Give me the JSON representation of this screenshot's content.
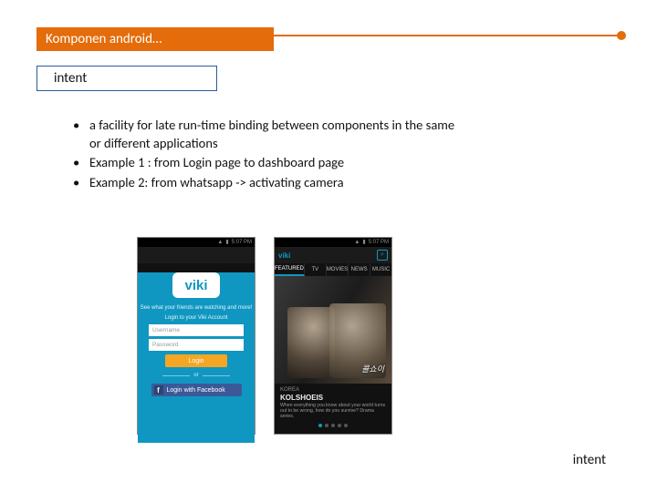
{
  "header": {
    "title": "Komponen android…"
  },
  "subtitle": "intent",
  "bullets": [
    "a facility for late run-time binding between components in the same or different applications",
    "Example 1 : from Login page to dashboard page",
    "Example 2: from whatsapp -> activating camera"
  ],
  "footer_label": "intent",
  "phone1": {
    "status_time": "5:07 PM",
    "brand": "viki",
    "tagline": "See what your friends are watching and more!",
    "login_hint": "Login to your Viki Account",
    "username_ph": "Username",
    "password_ph": "Password",
    "login_btn": "Login",
    "or": "or",
    "fb_btn": "Login with Facebook"
  },
  "phone2": {
    "status_time": "5:07 PM",
    "brand": "viki",
    "tabs": [
      "FEATURED",
      "TV",
      "MOVIES",
      "NEWS",
      "MUSIC"
    ],
    "active_tab": "FEATURED",
    "hero_tag": "KOREA",
    "hero_title": "KOLSHOEIS",
    "hero_desc": "When everything you know about your world turns out to be wrong, how do you survive? Drama series.",
    "hero_script": "콜쇼이"
  }
}
